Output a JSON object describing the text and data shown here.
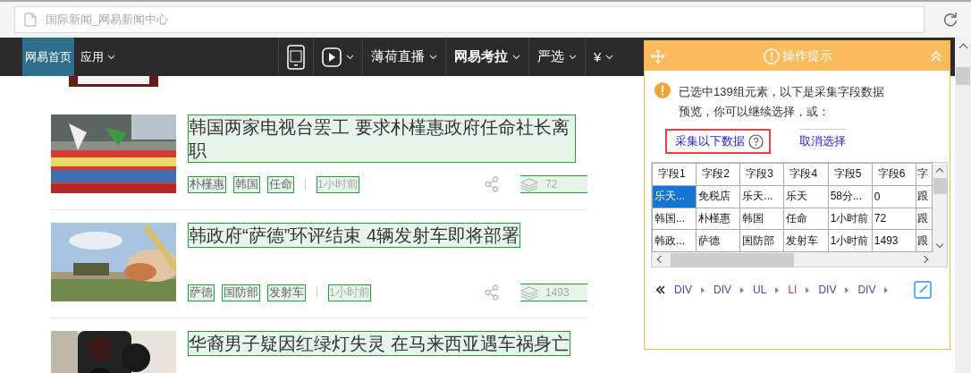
{
  "address_bar": {
    "title": "国际新闻_网易新闻中心"
  },
  "nav": {
    "items": [
      {
        "label": "网易首页",
        "caret": false,
        "selected": true
      },
      {
        "label": "应用",
        "caret": true,
        "selected": false
      }
    ],
    "right_items": [
      {
        "kind": "phone",
        "caret": false
      },
      {
        "kind": "play",
        "caret": true
      },
      {
        "kind": "text",
        "label": "薄荷直播",
        "caret": true,
        "bold": false
      },
      {
        "kind": "text",
        "label": "网易考拉",
        "caret": true,
        "bold": true
      },
      {
        "kind": "text",
        "label": "严选",
        "caret": true,
        "bold": false
      },
      {
        "kind": "text",
        "label": "¥",
        "caret": true,
        "bold": false
      }
    ]
  },
  "articles": [
    {
      "title": "韩国两家电视台罢工 要求朴槿惠政府任命社长离职",
      "tags": [
        "朴槿惠",
        "韩国",
        "任命"
      ],
      "time": "1小时前",
      "comments": "72"
    },
    {
      "title": "韩政府“萨德”环评结束 4辆发射车即将部署",
      "tags": [
        "萨德",
        "国防部",
        "发射车"
      ],
      "time": "1小时前",
      "comments": "1493"
    },
    {
      "title": "华裔男子疑因红绿灯失灵 在马来西亚遇车祸身亡"
    }
  ],
  "panel": {
    "title": "操作提示",
    "message": "已选中139组元素，以下是采集字段数据预览，你可以继续选择，或：",
    "collect_link": "采集以下数据",
    "cancel_link": "取消选择",
    "table": {
      "columns": [
        "字段1",
        "字段2",
        "字段3",
        "字段4",
        "字段5",
        "字段6",
        "字"
      ],
      "rows": [
        [
          {
            "text": "乐天...",
            "selected": true
          },
          {
            "text": "免税店",
            "selected": false
          },
          {
            "text": "乐天...",
            "selected": false
          },
          {
            "text": "乐天",
            "selected": false
          },
          {
            "text": "58分...",
            "selected": false
          },
          {
            "text": "0",
            "selected": false
          },
          {
            "text": "跟",
            "selected": false
          }
        ],
        [
          {
            "text": "韩国...",
            "selected": false
          },
          {
            "text": "朴槿惠",
            "selected": false
          },
          {
            "text": "韩国",
            "selected": false
          },
          {
            "text": "任命",
            "selected": false
          },
          {
            "text": "1小时前",
            "selected": false
          },
          {
            "text": "72",
            "selected": false
          },
          {
            "text": "跟",
            "selected": false
          }
        ],
        [
          {
            "text": "韩政...",
            "selected": false
          },
          {
            "text": "萨德",
            "selected": false
          },
          {
            "text": "国防部",
            "selected": false
          },
          {
            "text": "发射车",
            "selected": false
          },
          {
            "text": "1小时前",
            "selected": false
          },
          {
            "text": "1493",
            "selected": false
          },
          {
            "text": "跟",
            "selected": false
          }
        ]
      ]
    },
    "breadcrumb": [
      {
        "label": "DIV",
        "selected": false
      },
      {
        "label": "DIV",
        "selected": false
      },
      {
        "label": "UL",
        "selected": false
      },
      {
        "label": "LI",
        "selected": true
      },
      {
        "label": "DIV",
        "selected": false
      },
      {
        "label": "DIV",
        "selected": false
      }
    ]
  }
}
